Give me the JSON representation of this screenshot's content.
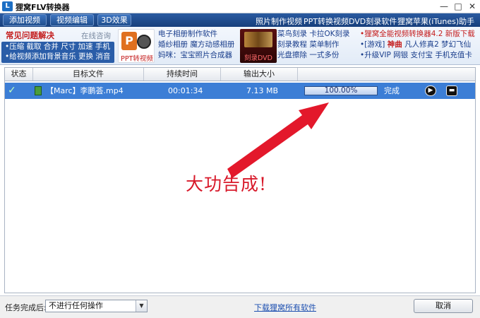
{
  "window": {
    "icon_letter": "L",
    "title": "狸窝FLV转换器",
    "controls": [
      "—",
      "□",
      "✕"
    ]
  },
  "toolbar": {
    "buttons": [
      "添加视频",
      "视频编辑",
      "3D效果"
    ],
    "links": [
      "照片制作视频",
      "PPT转换视频",
      "DVD刻录软件",
      "狸窝苹果(iTunes)助手"
    ]
  },
  "ads": {
    "faq": {
      "title": "常见问题解决",
      "online": "在线咨询",
      "line1": "•压缩 截取 合并 尺寸 加速 手机",
      "line2": "•给视频添加背景音乐 更换 消音"
    },
    "ppt_thumb": {
      "big": "P",
      "caption": "PPT转视频"
    },
    "col1": [
      "电子相册制作软件",
      "婚纱相册 魔方动感相册",
      "妈咪：宝宝照片合成器"
    ],
    "dvd_thumb": {
      "caption": "刻录DVD"
    },
    "col2": [
      "菜鸟刻录 卡拉OK刻录",
      "刻录教程 菜单制作",
      "光盘擦除 一式多份"
    ],
    "col3": {
      "line1": "•狸窝全能视频转换器4.2 新版下载",
      "line2a": "•[游戏] ",
      "line2b": "神曲",
      "line2c": " 凡人修真2 梦幻飞仙",
      "line3": "•升级VIP 网银 支付宝 手机充值卡"
    }
  },
  "table": {
    "headers": [
      "状态",
      "目标文件",
      "持续时间",
      "输出大小"
    ],
    "rows": [
      {
        "status_icon": "check-icon",
        "file_icon": "video-file-icon",
        "file": "【Marc】李鹏荟.mp4",
        "duration": "00:01:34",
        "size": "7.13 MB",
        "progress": "100.00%",
        "progress_fraction": 1.0,
        "state": "完成"
      }
    ]
  },
  "annotation": "大功告成!",
  "bottom": {
    "after_label": "任务完成后:",
    "after_value": "不进行任何操作",
    "download_link": "下载狸窝所有软件",
    "cancel": "取消"
  },
  "colors": {
    "accent": "#2a5aa0",
    "row_selected": "#3c7ed6",
    "annotation": "#d8192a"
  }
}
